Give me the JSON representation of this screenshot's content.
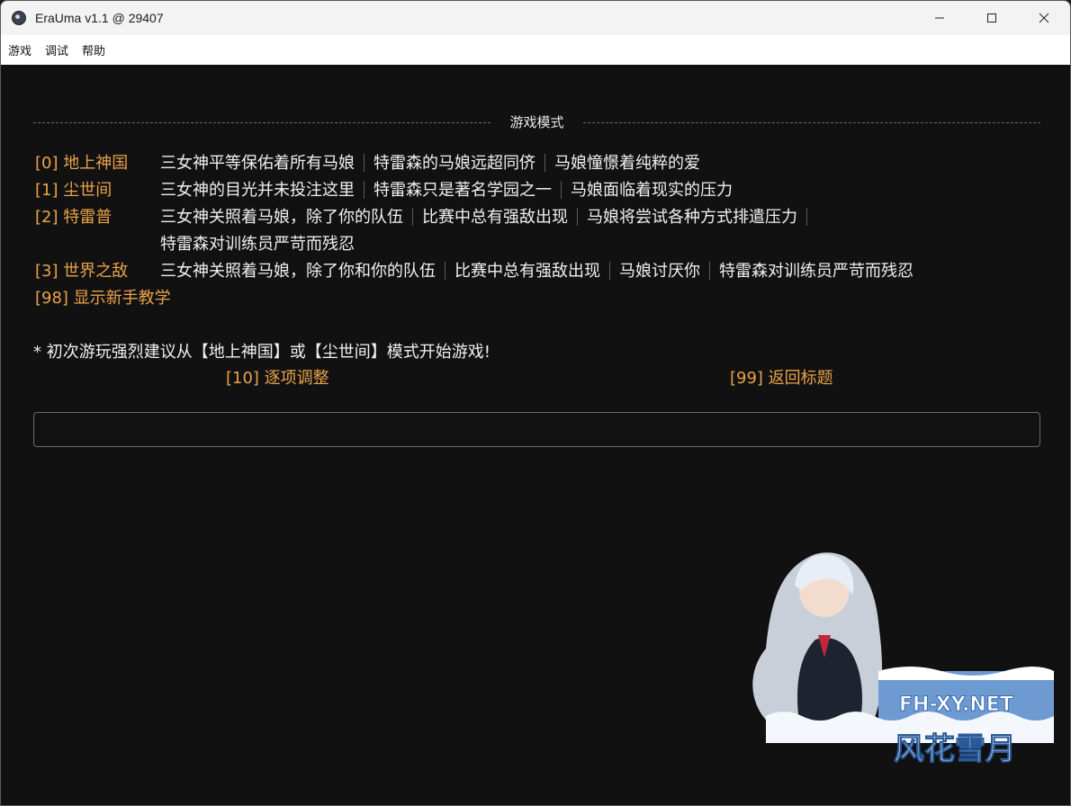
{
  "window": {
    "title": "EraUma v1.1 @ 29407"
  },
  "menu": [
    "游戏",
    "调试",
    "帮助"
  ],
  "section_title": "游戏模式",
  "modes": [
    {
      "option": "[0] 地上神国",
      "desc": [
        "三女神平等保佑着所有马娘",
        "特雷森的马娘远超同侪",
        "马娘憧憬着纯粹的爱"
      ]
    },
    {
      "option": "[1] 尘世间",
      "desc": [
        "三女神的目光并未投注这里",
        "特雷森只是著名学园之一",
        "马娘面临着现实的压力"
      ]
    },
    {
      "option": "[2] 特雷普",
      "desc": [
        "三女神关照着马娘，除了你的队伍",
        "比赛中总有强敌出现",
        "马娘将尝试各种方式排遣压力"
      ],
      "desc2": "特雷森对训练员严苛而残忍"
    },
    {
      "option": "[3] 世界之敌",
      "desc": [
        "三女神关照着马娘，除了你和你的队伍",
        "比赛中总有强敌出现",
        "马娘讨厌你",
        "特雷森对训练员严苛而残忍"
      ]
    }
  ],
  "tutorial": "[98] 显示新手教学",
  "note": "* 初次游玩强烈建议从【地上神国】或【尘世间】模式开始游戏!",
  "adjust": "[10] 逐项调整",
  "back": "[99] 返回标题",
  "watermark": {
    "site": "FH-XY.NET",
    "name": "风花雪月"
  },
  "colors": {
    "background": "#111111",
    "option": "#e9a24a",
    "text": "#f0f0f0"
  }
}
